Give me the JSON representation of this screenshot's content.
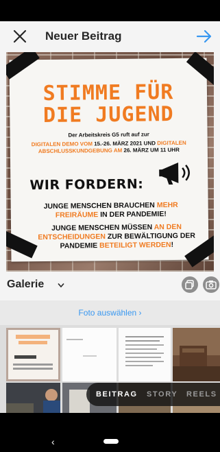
{
  "header": {
    "title": "Neuer Beitrag"
  },
  "post": {
    "headline_line1": "STIMME FÜR",
    "headline_line2": "DIE JUGEND",
    "org_line": "Der Arbeitskreis G5 ruft auf zur",
    "demo_a": "DIGITALEN DEMO VOM",
    "demo_b": " 15.-26. MÄRZ 2021 UND ",
    "demo_c": "DIGITALEN ABSCHLUSSKUNDGEBUNG AM",
    "demo_d": " 26. MÄRZ UM 11 UHR",
    "demand_heading": "WIR FORDERN:",
    "d1_a": "JUNGE MENSCHEN BRAUCHEN ",
    "d1_b": "MEHR FREIRÄUME",
    "d1_c": " IN DER PANDEMIE!",
    "d2_a": "JUNGE MENSCHEN MÜSSEN ",
    "d2_b": "AN DEN ENTSCHEIDUNGEN",
    "d2_c": " ZUR BEWÄLTIGUNG DER PANDEMIE ",
    "d2_d": "BETEILIGT WERDEN",
    "d2_e": "!"
  },
  "gallery": {
    "label": "Galerie"
  },
  "photo_select": {
    "label": "Foto auswählen"
  },
  "modes": [
    "BEITRAG",
    "STORY",
    "REELS"
  ],
  "colors": {
    "accent_blue": "#3897f0",
    "poster_orange": "#f07b21"
  }
}
